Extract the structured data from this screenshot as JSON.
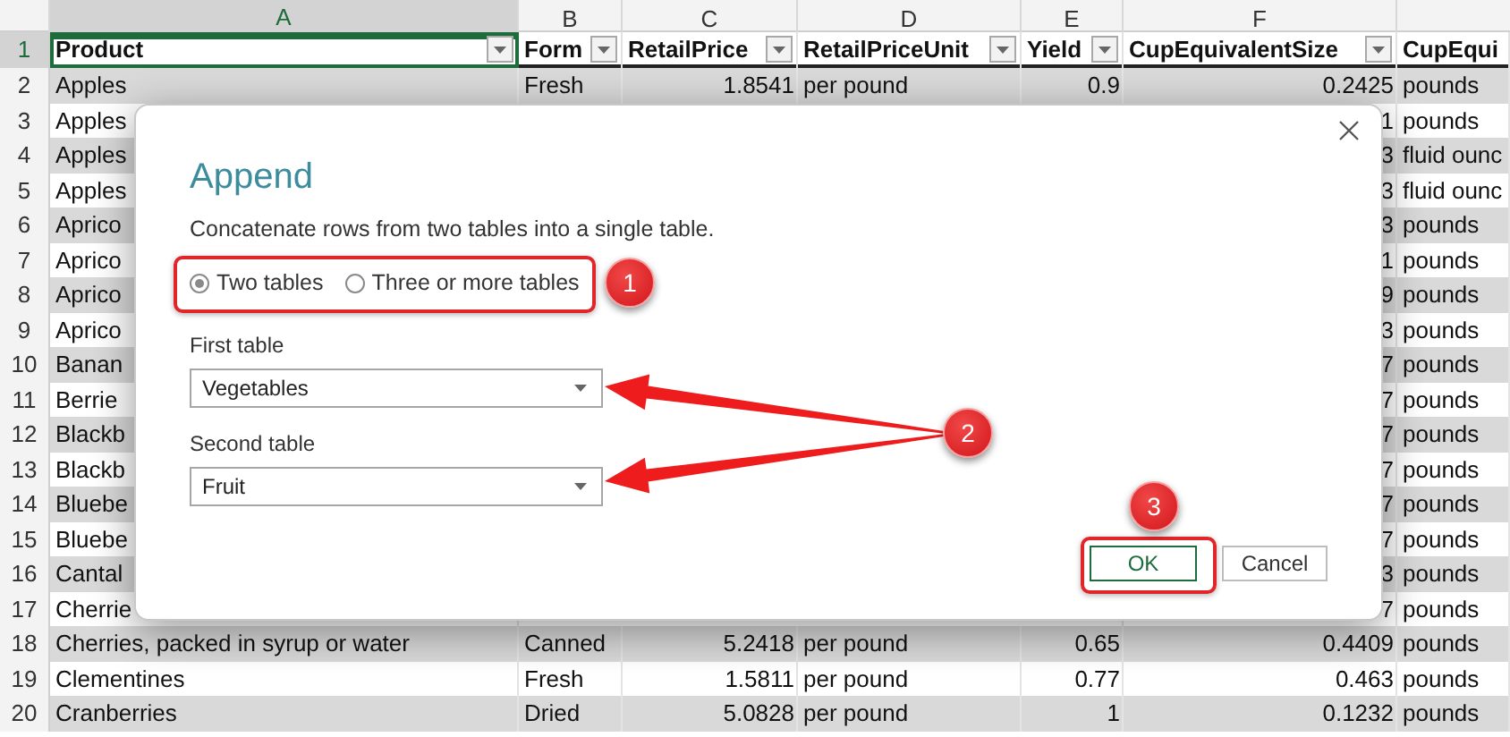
{
  "sheet": {
    "columns": [
      {
        "letter": "A",
        "selected": true
      },
      {
        "letter": "B",
        "selected": false
      },
      {
        "letter": "C",
        "selected": false
      },
      {
        "letter": "D",
        "selected": false
      },
      {
        "letter": "E",
        "selected": false
      },
      {
        "letter": "F",
        "selected": false
      }
    ],
    "header_row": {
      "number": "1",
      "cells": [
        "Product",
        "Form",
        "RetailPrice",
        "RetailPriceUnit",
        "Yield",
        "CupEquivalentSize",
        "CupEqui"
      ]
    },
    "rows": [
      {
        "number": "2",
        "kind": "full",
        "cells": [
          "Apples",
          "Fresh",
          "1.8541",
          "per pound",
          "0.9",
          "0.2425",
          "pounds"
        ]
      },
      {
        "number": "3",
        "kind": "covered",
        "cells": [
          "Apples",
          "1",
          "pounds"
        ]
      },
      {
        "number": "4",
        "kind": "covered",
        "cells": [
          "Apples",
          "3",
          "fluid ounc"
        ]
      },
      {
        "number": "5",
        "kind": "covered",
        "cells": [
          "Apples",
          "3",
          "fluid ounc"
        ]
      },
      {
        "number": "6",
        "kind": "covered",
        "cells": [
          "Aprico",
          "3",
          "pounds"
        ]
      },
      {
        "number": "7",
        "kind": "covered",
        "cells": [
          "Aprico",
          "1",
          "pounds"
        ]
      },
      {
        "number": "8",
        "kind": "covered",
        "cells": [
          "Aprico",
          "9",
          "pounds"
        ]
      },
      {
        "number": "9",
        "kind": "covered",
        "cells": [
          "Aprico",
          "3",
          "pounds"
        ]
      },
      {
        "number": "10",
        "kind": "covered",
        "cells": [
          "Banan",
          "7",
          "pounds"
        ]
      },
      {
        "number": "11",
        "kind": "covered",
        "cells": [
          "Berrie",
          "7",
          "pounds"
        ]
      },
      {
        "number": "12",
        "kind": "covered",
        "cells": [
          "Blackb",
          "7",
          "pounds"
        ]
      },
      {
        "number": "13",
        "kind": "covered",
        "cells": [
          "Blackb",
          "7",
          "pounds"
        ]
      },
      {
        "number": "14",
        "kind": "covered",
        "cells": [
          "Bluebe",
          "7",
          "pounds"
        ]
      },
      {
        "number": "15",
        "kind": "covered",
        "cells": [
          "Bluebe",
          "7",
          "pounds"
        ]
      },
      {
        "number": "16",
        "kind": "covered",
        "cells": [
          "Cantal",
          "3",
          "pounds"
        ]
      },
      {
        "number": "17",
        "kind": "covered",
        "cells": [
          "Cherrie",
          "7",
          "pounds"
        ]
      },
      {
        "number": "18",
        "kind": "full",
        "cells": [
          "Cherries, packed in syrup or water",
          "Canned",
          "5.2418",
          "per pound",
          "0.65",
          "0.4409",
          "pounds"
        ]
      },
      {
        "number": "19",
        "kind": "full",
        "cells": [
          "Clementines",
          "Fresh",
          "1.5811",
          "per pound",
          "0.77",
          "0.463",
          "pounds"
        ]
      },
      {
        "number": "20",
        "kind": "full",
        "cells": [
          "Cranberries",
          "Dried",
          "5.0828",
          "per pound",
          "1",
          "0.1232",
          "pounds"
        ]
      }
    ]
  },
  "dialog": {
    "title": "Append",
    "description": "Concatenate rows from two tables into a single table.",
    "options": [
      {
        "label": "Two tables",
        "selected": true
      },
      {
        "label": "Three or more tables",
        "selected": false
      }
    ],
    "fields": [
      {
        "label": "First table",
        "value": "Vegetables"
      },
      {
        "label": "Second table",
        "value": "Fruit"
      }
    ],
    "buttons": [
      {
        "label": "OK",
        "kind": "primary"
      },
      {
        "label": "Cancel",
        "kind": "secondary"
      }
    ]
  },
  "annotations": [
    {
      "label": "1"
    },
    {
      "label": "2"
    },
    {
      "label": "3"
    }
  ]
}
